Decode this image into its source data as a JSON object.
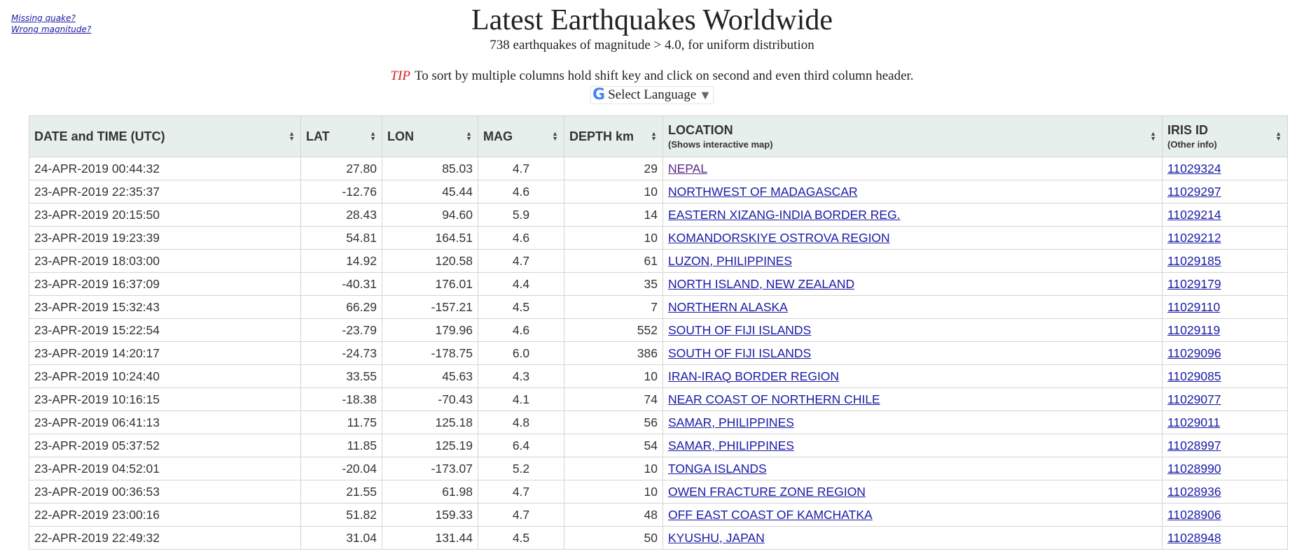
{
  "side_links": [
    "Missing quake?",
    "Wrong magnitude?"
  ],
  "title": "Latest Earthquakes Worldwide",
  "subtitle": "738 earthquakes of magnitude > 4.0, for uniform distribution",
  "tip": {
    "label": "TIP",
    "text": "To sort by multiple columns hold shift key and click on second and even third column header."
  },
  "language": {
    "label": "Select Language"
  },
  "columns": [
    {
      "label": "DATE and TIME (UTC)",
      "sub": ""
    },
    {
      "label": "LAT",
      "sub": ""
    },
    {
      "label": "LON",
      "sub": ""
    },
    {
      "label": "MAG",
      "sub": ""
    },
    {
      "label": "DEPTH km",
      "sub": ""
    },
    {
      "label": "LOCATION",
      "sub": "(Shows interactive map)"
    },
    {
      "label": "IRIS ID",
      "sub": "(Other info)"
    }
  ],
  "rows": [
    {
      "datetime": "24-APR-2019 00:44:32",
      "lat": "27.80",
      "lon": "85.03",
      "mag": "4.7",
      "depth": "29",
      "location": "NEPAL",
      "iris": "11029324"
    },
    {
      "datetime": "23-APR-2019 22:35:37",
      "lat": "-12.76",
      "lon": "45.44",
      "mag": "4.6",
      "depth": "10",
      "location": "NORTHWEST OF MADAGASCAR",
      "iris": "11029297"
    },
    {
      "datetime": "23-APR-2019 20:15:50",
      "lat": "28.43",
      "lon": "94.60",
      "mag": "5.9",
      "depth": "14",
      "location": "EASTERN XIZANG-INDIA BORDER REG.",
      "iris": "11029214"
    },
    {
      "datetime": "23-APR-2019 19:23:39",
      "lat": "54.81",
      "lon": "164.51",
      "mag": "4.6",
      "depth": "10",
      "location": "KOMANDORSKIYE OSTROVA REGION",
      "iris": "11029212"
    },
    {
      "datetime": "23-APR-2019 18:03:00",
      "lat": "14.92",
      "lon": "120.58",
      "mag": "4.7",
      "depth": "61",
      "location": "LUZON, PHILIPPINES",
      "iris": "11029185"
    },
    {
      "datetime": "23-APR-2019 16:37:09",
      "lat": "-40.31",
      "lon": "176.01",
      "mag": "4.4",
      "depth": "35",
      "location": "NORTH ISLAND, NEW ZEALAND",
      "iris": "11029179"
    },
    {
      "datetime": "23-APR-2019 15:32:43",
      "lat": "66.29",
      "lon": "-157.21",
      "mag": "4.5",
      "depth": "7",
      "location": "NORTHERN ALASKA",
      "iris": "11029110"
    },
    {
      "datetime": "23-APR-2019 15:22:54",
      "lat": "-23.79",
      "lon": "179.96",
      "mag": "4.6",
      "depth": "552",
      "location": "SOUTH OF FIJI ISLANDS",
      "iris": "11029119"
    },
    {
      "datetime": "23-APR-2019 14:20:17",
      "lat": "-24.73",
      "lon": "-178.75",
      "mag": "6.0",
      "depth": "386",
      "location": "SOUTH OF FIJI ISLANDS",
      "iris": "11029096"
    },
    {
      "datetime": "23-APR-2019 10:24:40",
      "lat": "33.55",
      "lon": "45.63",
      "mag": "4.3",
      "depth": "10",
      "location": "IRAN-IRAQ BORDER REGION",
      "iris": "11029085"
    },
    {
      "datetime": "23-APR-2019 10:16:15",
      "lat": "-18.38",
      "lon": "-70.43",
      "mag": "4.1",
      "depth": "74",
      "location": "NEAR COAST OF NORTHERN CHILE",
      "iris": "11029077"
    },
    {
      "datetime": "23-APR-2019 06:41:13",
      "lat": "11.75",
      "lon": "125.18",
      "mag": "4.8",
      "depth": "56",
      "location": "SAMAR, PHILIPPINES",
      "iris": "11029011"
    },
    {
      "datetime": "23-APR-2019 05:37:52",
      "lat": "11.85",
      "lon": "125.19",
      "mag": "6.4",
      "depth": "54",
      "location": "SAMAR, PHILIPPINES",
      "iris": "11028997"
    },
    {
      "datetime": "23-APR-2019 04:52:01",
      "lat": "-20.04",
      "lon": "-173.07",
      "mag": "5.2",
      "depth": "10",
      "location": "TONGA ISLANDS",
      "iris": "11028990"
    },
    {
      "datetime": "23-APR-2019 00:36:53",
      "lat": "21.55",
      "lon": "61.98",
      "mag": "4.7",
      "depth": "10",
      "location": "OWEN FRACTURE ZONE REGION",
      "iris": "11028936"
    },
    {
      "datetime": "22-APR-2019 23:00:16",
      "lat": "51.82",
      "lon": "159.33",
      "mag": "4.7",
      "depth": "48",
      "location": "OFF EAST COAST OF KAMCHATKA",
      "iris": "11028906"
    },
    {
      "datetime": "22-APR-2019 22:49:32",
      "lat": "31.04",
      "lon": "131.44",
      "mag": "4.5",
      "depth": "50",
      "location": "KYUSHU, JAPAN",
      "iris": "11028948"
    }
  ],
  "colors": {
    "header_bg": "#e7efec",
    "link": "#1a1aa6",
    "visited_link": "#5b2a86",
    "tip": "#d42020",
    "high_magnitude": "#e02020"
  },
  "highlight": {
    "visited_row": 0,
    "high_mag_row": 12
  }
}
